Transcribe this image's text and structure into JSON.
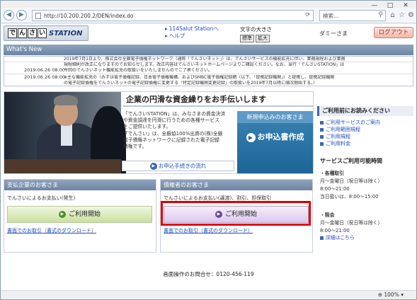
{
  "browser": {
    "url": "http://10.200.200.2/DEN/index.do",
    "search_placeholder": "検索...",
    "zoom": "100%",
    "window_controls": [
      "—",
      "□",
      "✕"
    ],
    "toolbar_icons": [
      "home-icon",
      "star-icon",
      "gear-icon"
    ]
  },
  "header": {
    "logo_glyphs": [
      "で",
      "ん",
      "さ",
      "い"
    ],
    "logo_word": "STATION",
    "links": [
      "114Salut Stationへ",
      "ヘルプ"
    ],
    "font_size_label": "文字の大きさ",
    "font_size_buttons": [
      "標準",
      "拡大"
    ],
    "user_name": "ダミーさま",
    "logout_label": "ログアウト"
  },
  "whats_new": {
    "title": "What's New",
    "items": [
      {
        "date": "",
        "text": "2019年7月1日より、株式会社全銀電子債権ネットワーク（通称「でんさいネット」）は、でんさいサービスの機能拡充に伴い、業務規程および業務"
      },
      {
        "date": "",
        "text": "規程細則が改正になりますのでお知らせします。改正内容はでんさいネットホームページよりご確認ください。なお、当行「でんさいSTATION」は"
      },
      {
        "date": "2019.06.26 08:00",
        "text": "今回のでんさいネット機能拡充の取扱いをいたしませんのでご了承ください。"
      },
      {
        "date": "2019.06.26 08:00",
        "text": "※主な機能拡充の（みずほ電子債権記録、日本電子債権機構、およびSMBC電子債権記録網（以下、「提携記録機関」）と提携し、提携記録機関"
      },
      {
        "date": "",
        "text": "の電子記録債権をでんさいネットの電子記録債権に変更する「特定記録機関変更記録」の取扱いを2019年7月以降に順次開始する。）"
      }
    ]
  },
  "banner": {
    "title": "企業の円滑な資金繰りをお手伝いします",
    "description": [
      "「でんさいSTATION」は、みなさまの資金決済",
      "や資金調達を円滑に行うための各種サービス",
      "をご提供いたします。",
      "「でんさい」は、全銀協100%出資の(株)全銀",
      "電子債権ネットワークに記録された電子記録",
      "債権です。"
    ],
    "procedure_link": "お申込手続きの流れ",
    "apply_header": "新規申込みのお客さま",
    "apply_button": "お申込書作成"
  },
  "sidebar": {
    "notice_title": "ご利用前にお読みください",
    "links": [
      "ご利用サービスのご案内",
      "ご利用範囲規程",
      "ご利用規程",
      "ご利用料金"
    ],
    "hours_title": "サービスご利用可能時間",
    "blocks": [
      {
        "title": "・各種取引",
        "lines": [
          "月～金曜日（祝日等は除く）",
          "8:00～21:00",
          "当日扱いは、8:00～15:00"
        ]
      },
      {
        "title": "・照会",
        "lines": [
          "月～金曜日（祝日等は除く）",
          "8:00～21:00"
        ]
      }
    ],
    "detail_link": "詳細はこちら"
  },
  "panels": {
    "payer": {
      "title": "支払企業のお客さま",
      "description": "でんさいによるお支払い(発生)",
      "button": "ご利用開始",
      "link": "書面でのお取引（書式のダウンロード）"
    },
    "creditor": {
      "title": "債権者のお客さま",
      "description": "でんさいによるお支払い(譲渡)、割引、担保取引",
      "button": "ご利用開始",
      "link": "書面でのお取引（書式のダウンロード）"
    }
  },
  "footer": {
    "contact": "画面操作のお問合せ：0120-456-119"
  },
  "colors": {
    "section_header": "#7a8fae",
    "logout": "#f0b9ac",
    "highlight": "#e00000",
    "apply_box": "#2a76a8",
    "link": "#1f4fb8"
  }
}
